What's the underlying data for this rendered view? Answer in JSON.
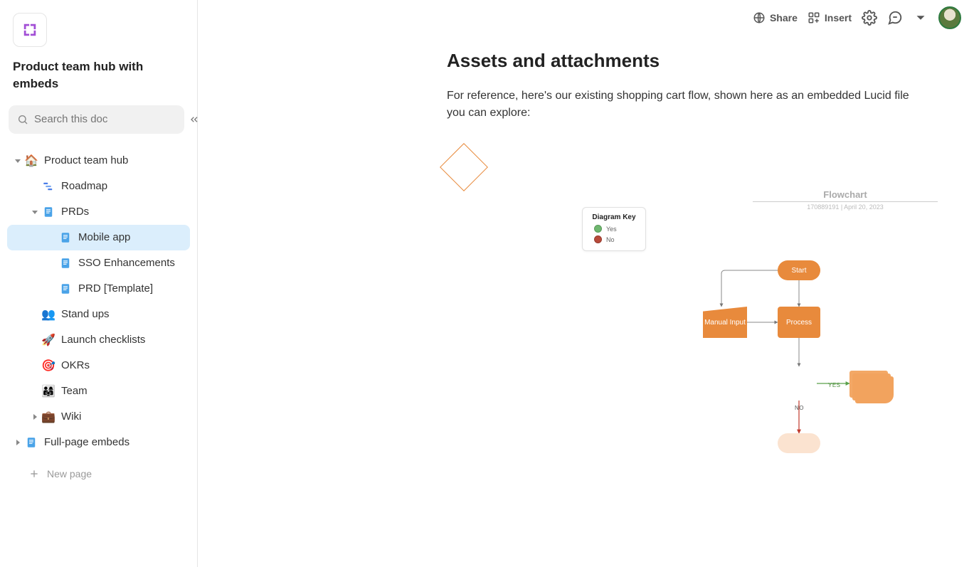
{
  "doc_title": "Product team hub with embeds",
  "search_placeholder": "Search this doc",
  "topbar": {
    "share": "Share",
    "insert": "Insert"
  },
  "sidebar": {
    "items": [
      {
        "label": "Product team hub",
        "icon": "🏠",
        "indent": 0,
        "caret": "down",
        "active": false
      },
      {
        "label": "Roadmap",
        "icon": "roadmap",
        "indent": 1,
        "caret": "none",
        "active": false
      },
      {
        "label": "PRDs",
        "icon": "page-blue",
        "indent": 1,
        "caret": "down",
        "active": false
      },
      {
        "label": "Mobile app",
        "icon": "page-blue",
        "indent": 2,
        "caret": "none",
        "active": true
      },
      {
        "label": "SSO Enhancements",
        "icon": "page-blue",
        "indent": 2,
        "caret": "none",
        "active": false
      },
      {
        "label": "PRD [Template]",
        "icon": "page-blue",
        "indent": 2,
        "caret": "none",
        "active": false
      },
      {
        "label": "Stand ups",
        "icon": "👥",
        "indent": 1,
        "caret": "none",
        "active": false
      },
      {
        "label": "Launch checklists",
        "icon": "🚀",
        "indent": 1,
        "caret": "none",
        "active": false
      },
      {
        "label": "OKRs",
        "icon": "🎯",
        "indent": 1,
        "caret": "none",
        "active": false
      },
      {
        "label": "Team",
        "icon": "👨‍👩‍👧",
        "indent": 1,
        "caret": "none",
        "active": false
      },
      {
        "label": "Wiki",
        "icon": "💼",
        "indent": 1,
        "caret": "right",
        "active": false
      },
      {
        "label": "Full-page embeds",
        "icon": "page-blue",
        "indent": 0,
        "caret": "right",
        "active": false
      }
    ],
    "new_page": "New page"
  },
  "page": {
    "heading": "Assets and attachments",
    "body": "For reference, here's our existing shopping cart flow, shown here as an embedded Lucid file you can explore:"
  },
  "flowchart": {
    "title": "Flowchart",
    "subtitle": "170889191  |  April 20, 2023",
    "key_title": "Diagram Key",
    "key_yes": "Yes",
    "key_no": "No",
    "nodes": {
      "start": "Start",
      "process": "Process",
      "manual": "Manual Input",
      "yes": "YES",
      "no": "NO"
    }
  }
}
